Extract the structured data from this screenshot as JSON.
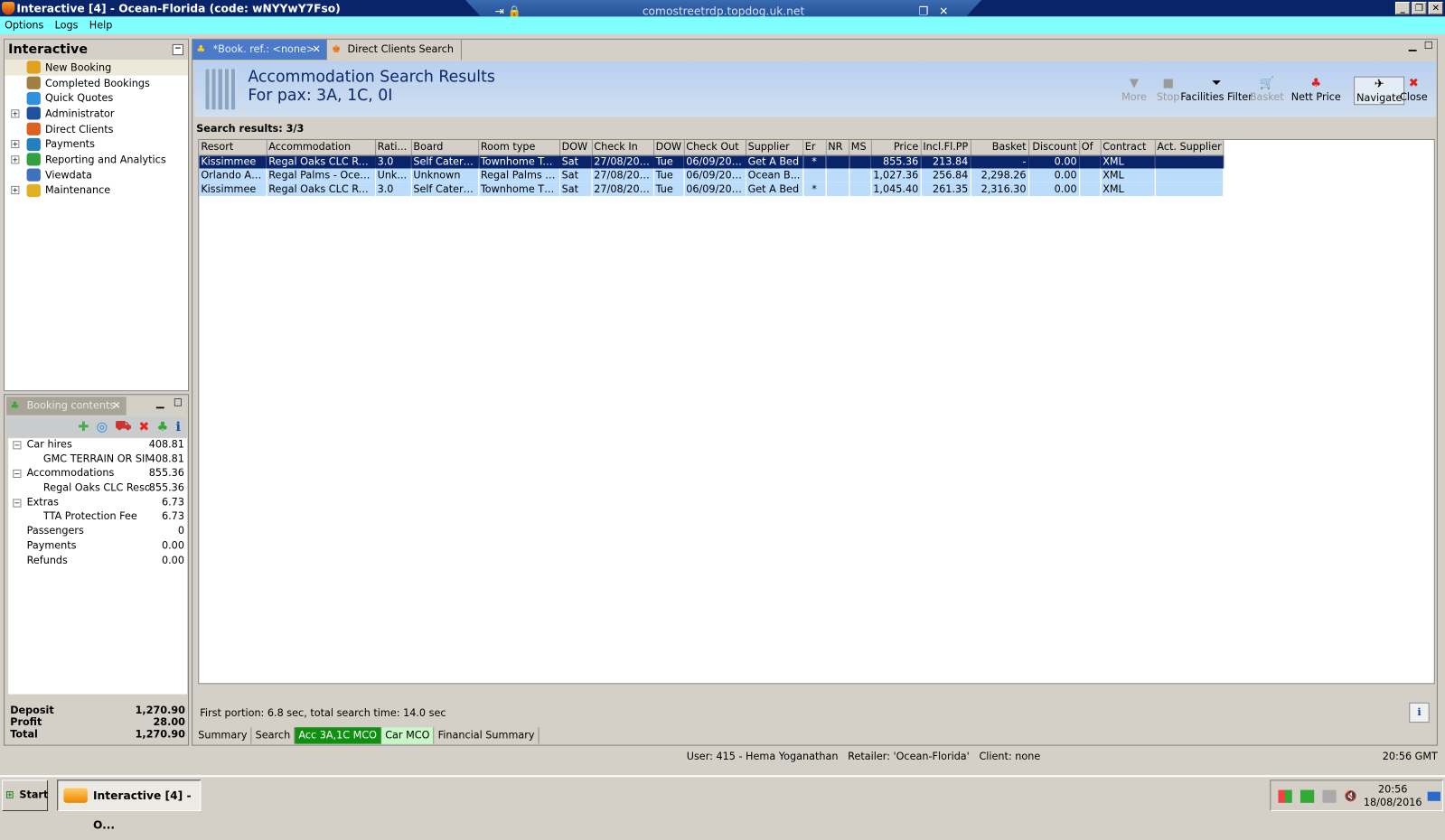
{
  "window": {
    "title": "Interactive [4] - Ocean-Florida (code: wNYYwY7Fso)",
    "rdp_host": "comostreetrdp.topdog.uk.net"
  },
  "menu": [
    "Options",
    "Logs",
    "Help"
  ],
  "nav": {
    "title": "Interactive",
    "items": [
      {
        "label": "New Booking",
        "expandable": false,
        "icon": "palm-tree-icon",
        "color": "#e0a020"
      },
      {
        "label": "Completed Bookings",
        "expandable": false,
        "icon": "palm-tree-icon",
        "color": "#a08040"
      },
      {
        "label": "Quick Quotes",
        "expandable": false,
        "icon": "clock-icon",
        "color": "#3090e0"
      },
      {
        "label": "Administrator",
        "expandable": true,
        "icon": "person-icon",
        "color": "#2050a0"
      },
      {
        "label": "Direct Clients",
        "expandable": false,
        "icon": "client-icon",
        "color": "#e06020"
      },
      {
        "label": "Payments",
        "expandable": true,
        "icon": "payment-icon",
        "color": "#2080c0"
      },
      {
        "label": "Reporting and Analytics",
        "expandable": true,
        "icon": "report-icon",
        "color": "#30a040"
      },
      {
        "label": "Viewdata",
        "expandable": false,
        "icon": "globe-icon",
        "color": "#4070c0"
      },
      {
        "label": "Maintenance",
        "expandable": true,
        "icon": "tools-icon",
        "color": "#e0b020"
      }
    ]
  },
  "booking": {
    "tab_label": "Booking contents",
    "toolbar": [
      "add-icon",
      "refresh-icon",
      "cart-icon",
      "delete-icon",
      "palm-tree-icon",
      "info-icon"
    ],
    "rows": [
      {
        "label": "Car hires",
        "value": "408.81",
        "level": 0,
        "expandable": true
      },
      {
        "label": "GMC TERRAIN OR SIM",
        "value": "408.81",
        "level": 1
      },
      {
        "label": "Accommodations",
        "value": "855.36",
        "level": 0,
        "expandable": true
      },
      {
        "label": "Regal Oaks CLC Resor",
        "value": "855.36",
        "level": 1
      },
      {
        "label": "Extras",
        "value": "6.73",
        "level": 0,
        "expandable": true
      },
      {
        "label": "TTA Protection Fee",
        "value": "6.73",
        "level": 1
      },
      {
        "label": "Passengers",
        "value": "0",
        "level": 0
      },
      {
        "label": "Payments",
        "value": "0.00",
        "level": 0
      },
      {
        "label": "Refunds",
        "value": "0.00",
        "level": 0
      }
    ],
    "totals": [
      {
        "label": "Deposit",
        "value": "1,270.90"
      },
      {
        "label": "Profit",
        "value": "28.00"
      },
      {
        "label": "Total",
        "value": "1,270.90"
      }
    ]
  },
  "tabs": [
    {
      "label": "*Book. ref.: <none>",
      "active": true
    },
    {
      "label": "Direct Clients Search",
      "active": false
    }
  ],
  "header": {
    "title": "Accommodation Search Results",
    "subtitle": "For pax: 3A, 1C, 0I"
  },
  "toolbar": [
    {
      "label": "More",
      "icon": "▼",
      "enabled": false
    },
    {
      "label": "Stop",
      "icon": "■",
      "enabled": false
    },
    {
      "label": "Facilities Filter",
      "icon": "⏷",
      "enabled": true
    },
    {
      "label": "Basket",
      "icon": "🛒",
      "enabled": false
    },
    {
      "label": "Nett Price",
      "icon": "♣",
      "enabled": true
    },
    {
      "label": "Navigate",
      "icon": "✈",
      "enabled": true
    },
    {
      "label": "Close",
      "icon": "✖",
      "enabled": true
    }
  ],
  "results_label": "Search results: 3/3",
  "columns": [
    "Resort",
    "Accommodation",
    "Rati...",
    "Board",
    "Room type",
    "DOW",
    "Check In",
    "DOW",
    "Check Out",
    "Supplier",
    "Er",
    "NR",
    "MS",
    "Price",
    "Incl.Fl.PP",
    "Basket",
    "Discount",
    "Of",
    "Contract",
    "Act. Supplier"
  ],
  "rows": [
    [
      "Kissimmee",
      "Regal Oaks CLC Resort",
      "3.0",
      "Self Catering",
      "Townhome Tw...",
      "Sat",
      "27/08/2016",
      "Tue",
      "06/09/2016",
      "Get A Bed",
      "*",
      "",
      "",
      "855.36",
      "213.84",
      "-",
      "0.00",
      "",
      "XML",
      ""
    ],
    [
      "Orlando Ar...",
      "Regal Palms - Ocean ...",
      "Unk...",
      "Unknown",
      "Regal Palms - ...",
      "Sat",
      "27/08/2016",
      "Tue",
      "06/09/2016",
      "Ocean B...",
      "",
      "",
      "",
      "1,027.36",
      "256.84",
      "2,298.26",
      "0.00",
      "",
      "XML",
      ""
    ],
    [
      "Kissimmee",
      "Regal Oaks CLC Resort",
      "3.0",
      "Self Catering",
      "Townhome Thr...",
      "Sat",
      "27/08/2016",
      "Tue",
      "06/09/2016",
      "Get A Bed",
      "*",
      "",
      "",
      "1,045.40",
      "261.35",
      "2,316.30",
      "0.00",
      "",
      "XML",
      ""
    ]
  ],
  "selected_row": 0,
  "timing": "First portion: 6.8 sec, total search time: 14.0 sec",
  "bottom_tabs": [
    "Summary",
    "Search",
    "Acc 3A,1C MCO",
    "Car MCO",
    "Financial Summary"
  ],
  "status": {
    "text": "User: 415 - Hema Yoganathan   Retailer: 'Ocean-Florida'   Client: none",
    "time": "20:56 GMT"
  },
  "taskbar": {
    "start": "Start",
    "item": "Interactive [4] - O...",
    "clock_time": "20:56",
    "clock_date": "18/08/2016"
  }
}
